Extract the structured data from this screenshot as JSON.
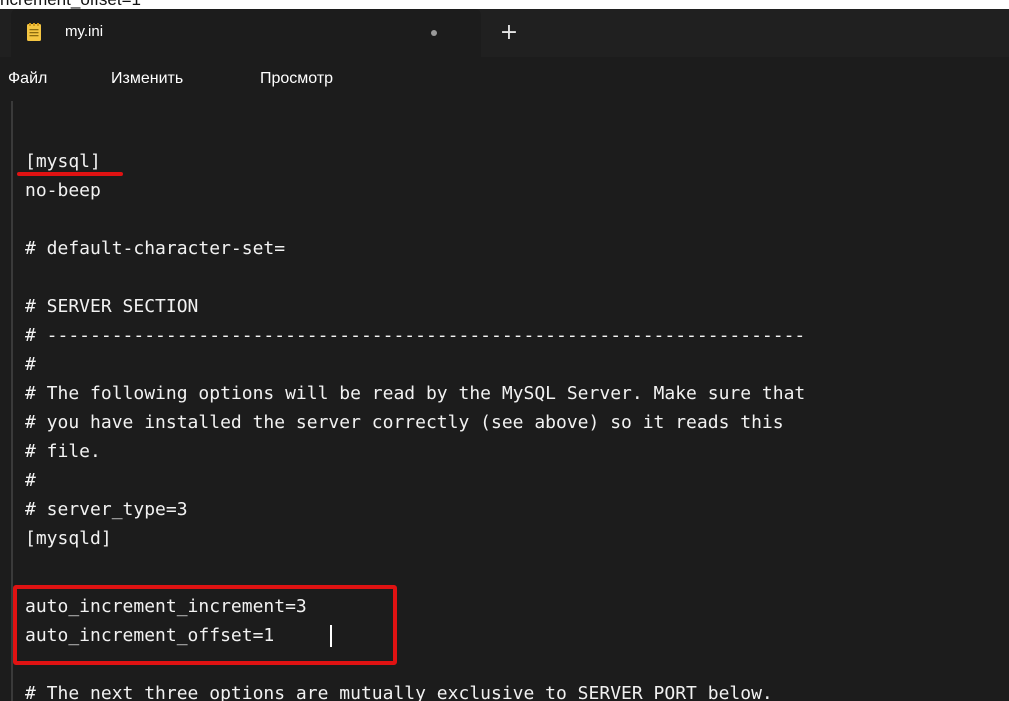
{
  "caption": "ncrement_offset=1",
  "tab": {
    "title": "my.ini",
    "icon": "notepad-icon",
    "unsaved_indicator": "●",
    "new_tab_label": "+"
  },
  "menu": {
    "file": "Файл",
    "edit": "Изменить",
    "view": "Просмотр"
  },
  "editor": {
    "lines": [
      "[mysql]",
      "no-beep",
      "",
      "# default-character-set=",
      "",
      "# SERVER SECTION",
      "# ----------------------------------------------------------------------",
      "#",
      "# The following options will be read by the MySQL Server. Make sure that",
      "# you have installed the server correctly (see above) so it reads this",
      "# file.",
      "#",
      "# server_type=3",
      "[mysqld]",
      "",
      "auto_increment_increment=3",
      "auto_increment_offset=1",
      "",
      "# The next three options are mutually exclusive to SERVER PORT below."
    ]
  },
  "colors": {
    "editor_bg": "#1c1c1c",
    "tabbar_bg": "#202020",
    "annotation_red": "#e01212",
    "text": "#f2f2f2"
  }
}
